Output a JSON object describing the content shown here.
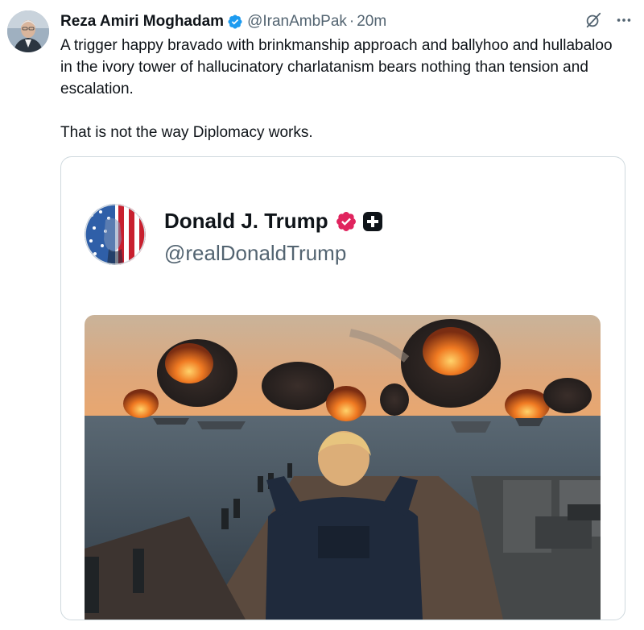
{
  "tweet": {
    "author_name": "Reza Amiri Moghadam",
    "author_handle": "@IranAmbPak",
    "separator": "·",
    "time": "20m",
    "paragraphs": [
      "A trigger happy bravado with brinkmanship approach and ballyhoo and hullabaloo in the ivory tower of hallucinatory charlatanism bears nothing than tension and escalation.",
      "That is not the way Diplomacy works."
    ]
  },
  "quoted": {
    "author_name": "Donald J. Trump",
    "author_handle": "@realDonaldTrump"
  },
  "icons": {
    "author_verified": "verified-badge-icon",
    "grok": "grok-icon",
    "more": "more-options-icon",
    "quoted_verified": "verified-badge-icon",
    "quoted_plus": "plus-badge-icon"
  },
  "colors": {
    "verified_blue": "#1d9bf0",
    "quoted_badge_pink": "#e0245e",
    "secondary_text": "#536471",
    "border": "#cfd9de"
  }
}
